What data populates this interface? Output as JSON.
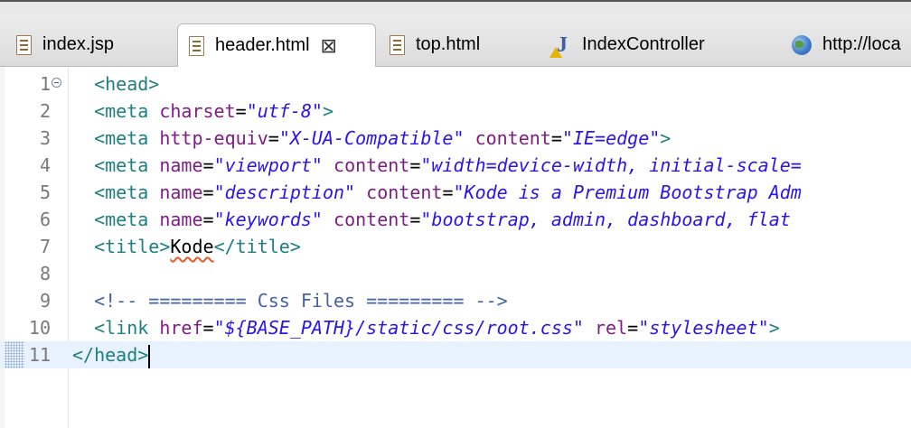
{
  "tabs": [
    {
      "label": "index.jsp",
      "icon": "html-file-icon"
    },
    {
      "label": "header.html",
      "icon": "html-file-icon",
      "active": true
    },
    {
      "label": "top.html",
      "icon": "html-file-icon"
    },
    {
      "label": "IndexController",
      "icon": "java-class-warning-icon"
    },
    {
      "label": "http://loca",
      "icon": "globe-icon"
    }
  ],
  "code_lines": [
    {
      "num": "1",
      "indent": "  ",
      "tokens": [
        [
          "tag",
          "<head>"
        ]
      ]
    },
    {
      "num": "2",
      "indent": "  ",
      "tokens": [
        [
          "tag",
          "<meta "
        ],
        [
          "attr",
          "charset"
        ],
        [
          "txt",
          "="
        ],
        [
          "val",
          "\"utf-8\""
        ],
        [
          "tag",
          ">"
        ]
      ]
    },
    {
      "num": "3",
      "indent": "  ",
      "tokens": [
        [
          "tag",
          "<meta "
        ],
        [
          "attr",
          "http-equiv"
        ],
        [
          "txt",
          "="
        ],
        [
          "val",
          "\"X-UA-Compatible\""
        ],
        [
          "txt",
          " "
        ],
        [
          "attr",
          "content"
        ],
        [
          "txt",
          "="
        ],
        [
          "val",
          "\"IE=edge\""
        ],
        [
          "tag",
          ">"
        ]
      ]
    },
    {
      "num": "4",
      "indent": "  ",
      "tokens": [
        [
          "tag",
          "<meta "
        ],
        [
          "attr",
          "name"
        ],
        [
          "txt",
          "="
        ],
        [
          "val",
          "\"viewport\""
        ],
        [
          "txt",
          " "
        ],
        [
          "attr",
          "content"
        ],
        [
          "txt",
          "="
        ],
        [
          "val",
          "\"width=device-width, initial-scale="
        ]
      ]
    },
    {
      "num": "5",
      "indent": "  ",
      "tokens": [
        [
          "tag",
          "<meta "
        ],
        [
          "attr",
          "name"
        ],
        [
          "txt",
          "="
        ],
        [
          "val",
          "\"description\""
        ],
        [
          "txt",
          " "
        ],
        [
          "attr",
          "content"
        ],
        [
          "txt",
          "="
        ],
        [
          "val",
          "\"Kode is a Premium Bootstrap Adm"
        ]
      ]
    },
    {
      "num": "6",
      "indent": "  ",
      "tokens": [
        [
          "tag",
          "<meta "
        ],
        [
          "attr",
          "name"
        ],
        [
          "txt",
          "="
        ],
        [
          "val",
          "\"keywords\""
        ],
        [
          "txt",
          " "
        ],
        [
          "attr",
          "content"
        ],
        [
          "txt",
          "="
        ],
        [
          "val",
          "\"bootstrap, admin, dashboard, flat"
        ]
      ]
    },
    {
      "num": "7",
      "indent": "  ",
      "tokens": [
        [
          "tag",
          "<title>"
        ],
        [
          "squig",
          "Kode"
        ],
        [
          "tag",
          "</title>"
        ]
      ]
    },
    {
      "num": "8",
      "indent": "",
      "tokens": []
    },
    {
      "num": "9",
      "indent": "  ",
      "tokens": [
        [
          "cmt",
          "<!-- ========= Css Files ========= -->"
        ]
      ]
    },
    {
      "num": "10",
      "indent": "  ",
      "tokens": [
        [
          "tag",
          "<link "
        ],
        [
          "attr",
          "href"
        ],
        [
          "txt",
          "="
        ],
        [
          "val",
          "\"${BASE_PATH}/static/css/root.css\""
        ],
        [
          "txt",
          " "
        ],
        [
          "attr",
          "rel"
        ],
        [
          "txt",
          "="
        ],
        [
          "val",
          "\"stylesheet\""
        ],
        [
          "tag",
          ">"
        ]
      ]
    },
    {
      "num": "11",
      "indent": "",
      "tokens": [
        [
          "tag",
          "</head>"
        ]
      ]
    }
  ],
  "colors": {
    "tag": "#1d7f7f",
    "attribute": "#7e1e84",
    "value": "#2a14ee",
    "comment": "#4462a8",
    "current_line": "#e8f2fe"
  }
}
